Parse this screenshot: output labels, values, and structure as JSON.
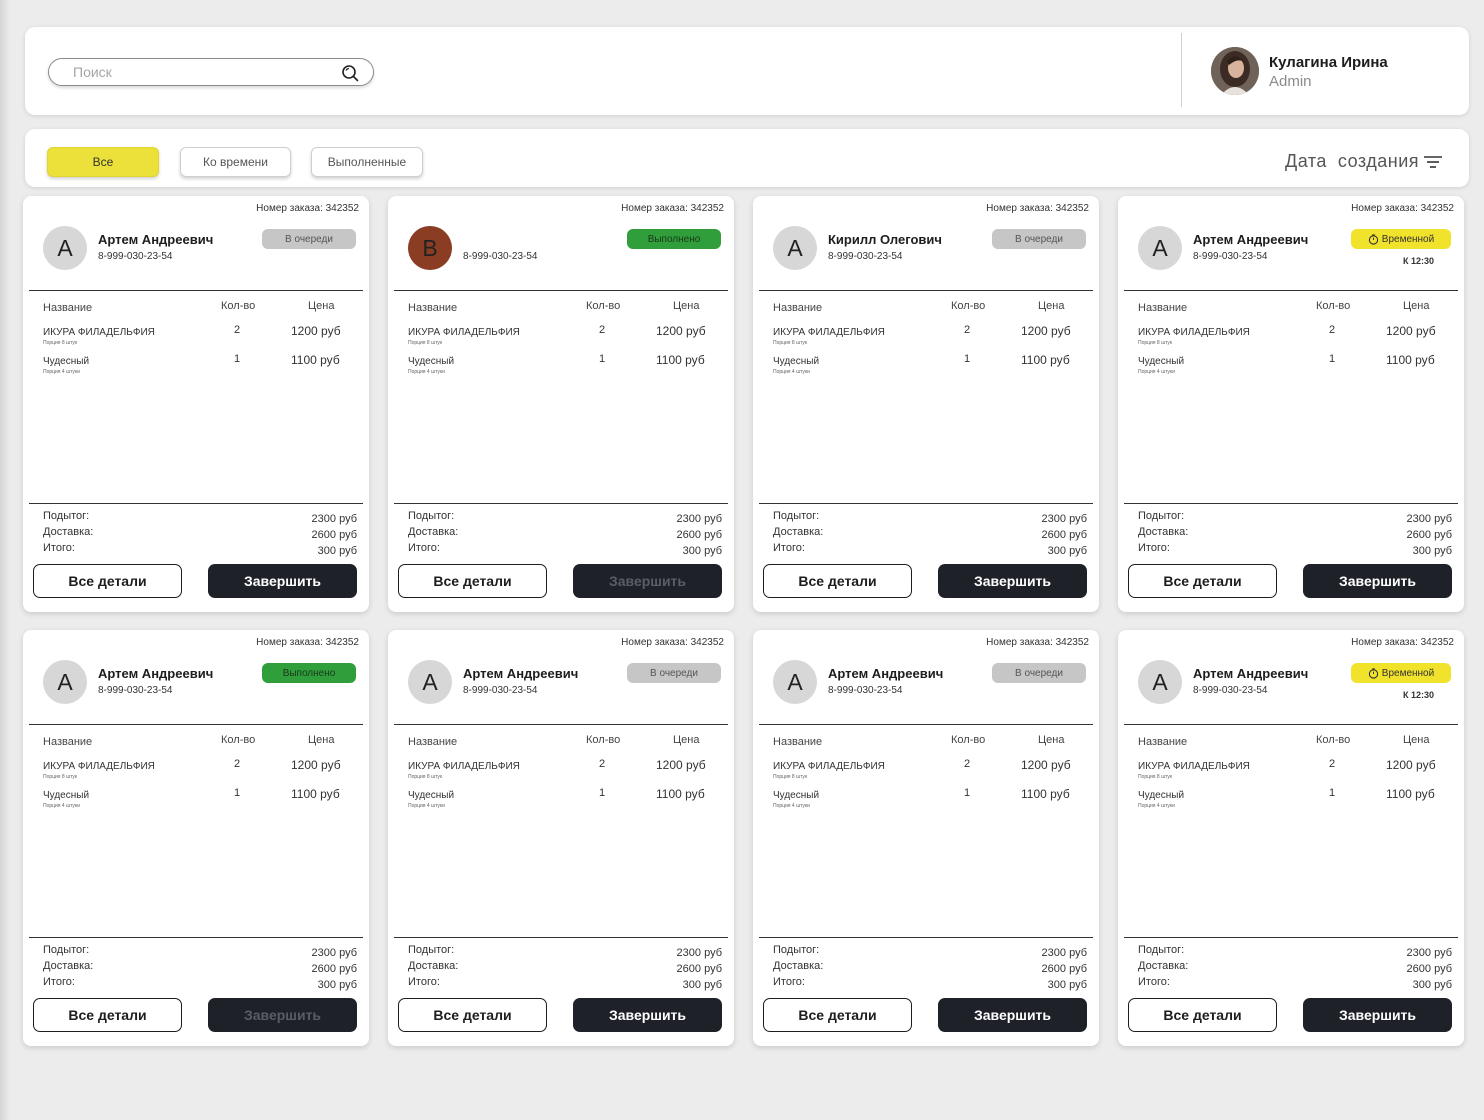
{
  "search": {
    "placeholder": "Поиск"
  },
  "user": {
    "name": "Кулагина Ирина",
    "role": "Admin"
  },
  "filters": {
    "all": "Все",
    "timed": "Ко времени",
    "completed": "Выполненные"
  },
  "sort": {
    "label": "Дата  создания"
  },
  "table_headers": {
    "name": "Название",
    "qty": "Кол-во",
    "price": "Цена"
  },
  "summary_labels": {
    "subtotal": "Подытог:",
    "delivery": "Доставка:",
    "total": "Итого:"
  },
  "buttons": {
    "details": "Все детали",
    "finish": "Завершить"
  },
  "status_labels": {
    "queue": "В очереди",
    "done": "Выполнено",
    "temp": "Временной"
  },
  "due_time": "К 12:30",
  "colors": {
    "accent_yellow": "#ece03a",
    "done_green": "#2f9e3b",
    "queue_gray": "#c6c6c6",
    "dark_button": "#1e2128"
  },
  "orders": [
    {
      "order_no": "Номер заказа: 342352",
      "initial": "А",
      "customer": "Артем Андреевич",
      "phone": "8-999-030-23-54",
      "status": "В очереди",
      "items": [
        {
          "name": "ИКУРА ФИЛАДЕЛЬФИЯ",
          "sub": "Порция 8 штук",
          "qty": "2",
          "price": "1200 руб"
        },
        {
          "name": "Чудесный",
          "sub": "Порция 4 штуки",
          "qty": "1",
          "price": "1100 руб"
        }
      ],
      "subtotal": "2300 руб",
      "delivery": "2600 руб",
      "total": "300 руб"
    },
    {
      "order_no": "Номер заказа: 342352",
      "initial": "В",
      "customer": "",
      "phone": "8-999-030-23-54",
      "status": "Выполнено",
      "items": [
        {
          "name": "ИКУРА ФИЛАДЕЛЬФИЯ",
          "sub": "Порция 8 штук",
          "qty": "2",
          "price": "1200 руб"
        },
        {
          "name": "Чудесный",
          "sub": "Порция 4 штуки",
          "qty": "1",
          "price": "1100 руб"
        }
      ],
      "subtotal": "2300 руб",
      "delivery": "2600 руб",
      "total": "300 руб"
    },
    {
      "order_no": "Номер заказа: 342352",
      "initial": "А",
      "customer": "Кирилл Олегович",
      "phone": "8-999-030-23-54",
      "status": "В очереди",
      "items": [
        {
          "name": "ИКУРА ФИЛАДЕЛЬФИЯ",
          "sub": "Порция 8 штук",
          "qty": "2",
          "price": "1200 руб"
        },
        {
          "name": "Чудесный",
          "sub": "Порция 4 штуки",
          "qty": "1",
          "price": "1100 руб"
        }
      ],
      "subtotal": "2300 руб",
      "delivery": "2600 руб",
      "total": "300 руб"
    },
    {
      "order_no": "Номер заказа: 342352",
      "initial": "А",
      "customer": "Артем Андреевич",
      "phone": "8-999-030-23-54",
      "status": "Временной",
      "items": [
        {
          "name": "ИКУРА ФИЛАДЕЛЬФИЯ",
          "sub": "Порция 8 штук",
          "qty": "2",
          "price": "1200 руб"
        },
        {
          "name": "Чудесный",
          "sub": "Порция 4 штуки",
          "qty": "1",
          "price": "1100 руб"
        }
      ],
      "subtotal": "2300 руб",
      "delivery": "2600 руб",
      "total": "300 руб"
    },
    {
      "order_no": "Номер заказа: 342352",
      "initial": "А",
      "customer": "Артем Андреевич",
      "phone": "8-999-030-23-54",
      "status": "Выполнено",
      "items": [
        {
          "name": "ИКУРА ФИЛАДЕЛЬФИЯ",
          "sub": "Порция 8 штук",
          "qty": "2",
          "price": "1200 руб"
        },
        {
          "name": "Чудесный",
          "sub": "Порция 4 штуки",
          "qty": "1",
          "price": "1100 руб"
        }
      ],
      "subtotal": "2300 руб",
      "delivery": "2600 руб",
      "total": "300 руб"
    },
    {
      "order_no": "Номер заказа: 342352",
      "initial": "А",
      "customer": "Артем Андреевич",
      "phone": "8-999-030-23-54",
      "status": "В очереди",
      "items": [
        {
          "name": "ИКУРА ФИЛАДЕЛЬФИЯ",
          "sub": "Порция 8 штук",
          "qty": "2",
          "price": "1200 руб"
        },
        {
          "name": "Чудесный",
          "sub": "Порция 4 штуки",
          "qty": "1",
          "price": "1100 руб"
        }
      ],
      "subtotal": "2300 руб",
      "delivery": "2600 руб",
      "total": "300 руб"
    },
    {
      "order_no": "Номер заказа: 342352",
      "initial": "А",
      "customer": "Артем Андреевич",
      "phone": "8-999-030-23-54",
      "status": "В очереди",
      "items": [
        {
          "name": "ИКУРА ФИЛАДЕЛЬФИЯ",
          "sub": "Порция 8 штук",
          "qty": "2",
          "price": "1200 руб"
        },
        {
          "name": "Чудесный",
          "sub": "Порция 4 штуки",
          "qty": "1",
          "price": "1100 руб"
        }
      ],
      "subtotal": "2300 руб",
      "delivery": "2600 руб",
      "total": "300 руб"
    },
    {
      "order_no": "Номер заказа: 342352",
      "initial": "А",
      "customer": "Артем Андреевич",
      "phone": "8-999-030-23-54",
      "status": "Временной",
      "items": [
        {
          "name": "ИКУРА ФИЛАДЕЛЬФИЯ",
          "sub": "Порция 8 штук",
          "qty": "2",
          "price": "1200 руб"
        },
        {
          "name": "Чудесный",
          "sub": "Порция 4 штуки",
          "qty": "1",
          "price": "1100 руб"
        }
      ],
      "subtotal": "2300 руб",
      "delivery": "2600 руб",
      "total": "300 руб"
    }
  ]
}
